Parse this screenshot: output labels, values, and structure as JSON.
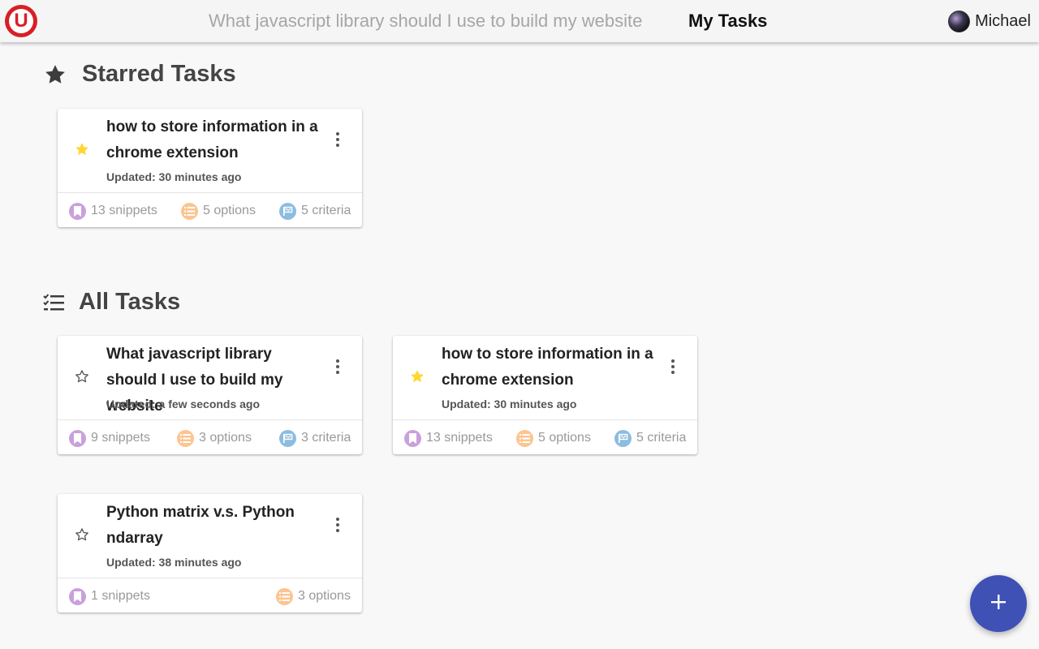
{
  "header": {
    "logo_letter": "U",
    "tabs": [
      {
        "label": "What javascript library should I use to build my website",
        "active": false
      },
      {
        "label": "My Tasks",
        "active": true
      }
    ],
    "user_name": "Michael"
  },
  "starred_section": {
    "title": "Starred Tasks",
    "icon": "star-icon"
  },
  "all_section": {
    "title": "All Tasks",
    "icon": "checklist-icon"
  },
  "starred_tasks": [
    {
      "title": "how to store information in a chrome extension",
      "updated": "Updated: 30 minutes ago",
      "starred": true,
      "snippets": "13 snippets",
      "options": "5 options",
      "criteria": "5 criteria"
    }
  ],
  "all_tasks": [
    {
      "title": "What javascript library should I use to build my website",
      "updated": "Updated: a few seconds ago",
      "starred": false,
      "snippets": "9 snippets",
      "options": "3 options",
      "criteria": "3 criteria"
    },
    {
      "title": "how to store information in a chrome extension",
      "updated": "Updated: 30 minutes ago",
      "starred": true,
      "snippets": "13 snippets",
      "options": "5 options",
      "criteria": "5 criteria"
    },
    {
      "title": "Python matrix v.s. Python ndarray",
      "updated": "Updated: 38 minutes ago",
      "starred": false,
      "snippets": "1 snippets",
      "options": "3 options"
    }
  ],
  "fab": {
    "icon": "plus-icon"
  },
  "colors": {
    "logo": "#d81f26",
    "fab": "#3f51b5",
    "star_filled": "#fdd835",
    "snippet_badge": "#c9a0dc",
    "option_badge": "#fcc590",
    "criteria_badge": "#8cbde0"
  }
}
